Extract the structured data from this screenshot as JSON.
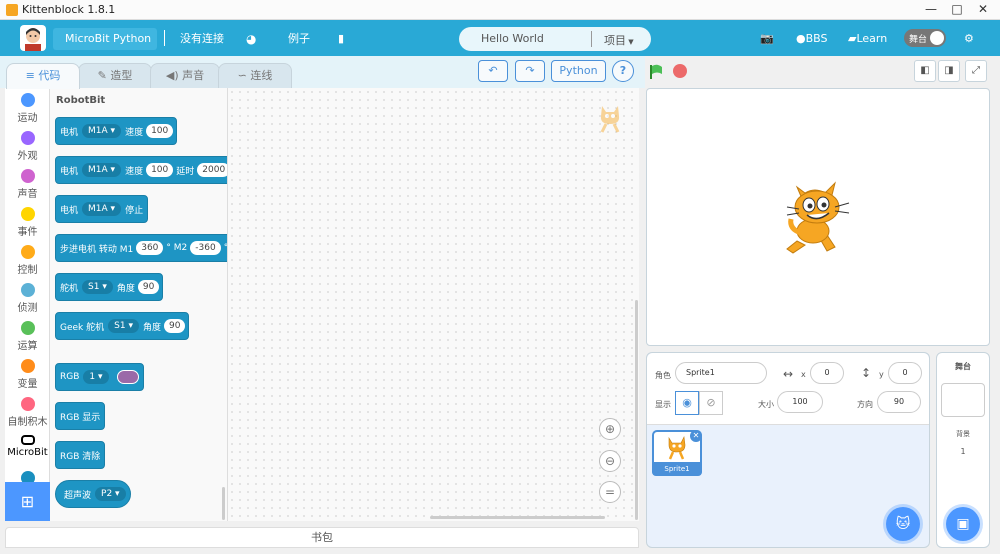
{
  "window": {
    "title": "Kittenblock 1.8.1",
    "minimize": "—",
    "maximize": "□",
    "close": "✕"
  },
  "menubar": {
    "device": "MicroBit Python",
    "connection": "没有连接",
    "examples": "例子",
    "project_name": "Hello World",
    "project_menu": "项目",
    "bbs": "BBS",
    "learn": "Learn",
    "stage_toggle": "舞台"
  },
  "tabs": [
    {
      "label": "代码"
    },
    {
      "label": "造型"
    },
    {
      "label": "声音"
    },
    {
      "label": "连线"
    }
  ],
  "toolbar": {
    "python": "Python",
    "help": "?"
  },
  "categories": [
    {
      "label": "运动",
      "color": "#4c97ff"
    },
    {
      "label": "外观",
      "color": "#9966ff"
    },
    {
      "label": "声音",
      "color": "#cf63cf"
    },
    {
      "label": "事件",
      "color": "#ffd500"
    },
    {
      "label": "控制",
      "color": "#ffab19"
    },
    {
      "label": "侦测",
      "color": "#5cb1d6"
    },
    {
      "label": "运算",
      "color": "#59c059"
    },
    {
      "label": "变量",
      "color": "#ff8c1a"
    },
    {
      "label": "自制积木",
      "color": "#ff6680"
    },
    {
      "label": "MicroBit",
      "color": "#000000"
    }
  ],
  "palette": {
    "title": "RobotBit",
    "blocks": [
      {
        "l1": "电机",
        "dd": "M1A",
        "l2": "速度",
        "v1": "100"
      },
      {
        "l1": "电机",
        "dd": "M1A",
        "l2": "速度",
        "v1": "100",
        "l3": "延时",
        "v2": "2000"
      },
      {
        "l1": "电机",
        "dd": "M1A",
        "l2": "停止"
      },
      {
        "l1": "步进电机 转动 M1",
        "v1": "360",
        "l2": "° M2",
        "v2": "-360",
        "l3": "°"
      },
      {
        "l1": "舵机",
        "dd": "S1",
        "l2": "角度",
        "v1": "90"
      },
      {
        "l1": "Geek 舵机",
        "dd": "S1",
        "l2": "角度",
        "v1": "90"
      },
      {
        "l1": "RGB",
        "dd": "1"
      },
      {
        "l1": "RGB 显示"
      },
      {
        "l1": "RGB 清除"
      },
      {
        "l1": "超声波",
        "dd": "P2"
      }
    ]
  },
  "backpack": "书包",
  "sprite": {
    "role_label": "角色",
    "name": "Sprite1",
    "x_label": "x",
    "x": "0",
    "y_label": "y",
    "y": "0",
    "show_label": "显示",
    "size_label": "大小",
    "size": "100",
    "direction_label": "方向",
    "direction": "90",
    "thumb_name": "Sprite1"
  },
  "stage_panel": {
    "title": "舞台",
    "backdrops_label": "背景",
    "backdrops_count": "1"
  }
}
